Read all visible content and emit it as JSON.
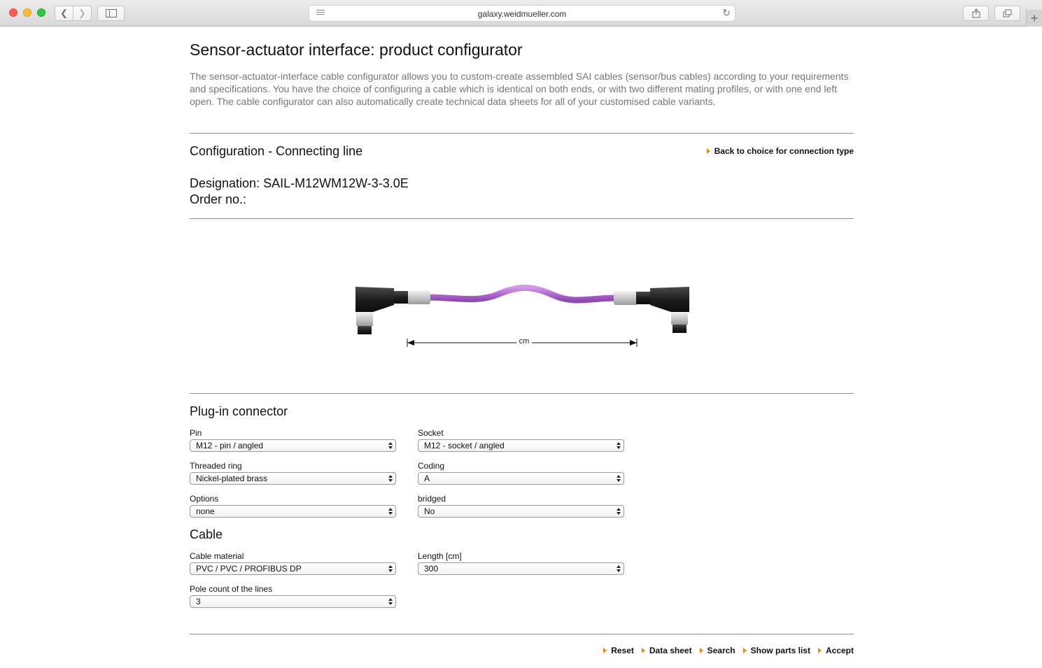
{
  "browser": {
    "url": "galaxy.weidmueller.com"
  },
  "page": {
    "title": "Sensor-actuator interface: product configurator",
    "intro": "The sensor-actuator-interface cable configurator allows you to custom-create assembled SAI cables (sensor/bus cables) according to your requirements and specifications. You have the choice of configuring a cable which is identical on both ends, or with two different mating profiles, or with one end left open. The cable configurator can also automatically create technical data sheets for all of your customised cable variants."
  },
  "configuration": {
    "title": "Configuration - Connecting line",
    "back_link": "Back to choice for connection type",
    "designation": "Designation: SAIL-M12WM12W-3-3.0E",
    "order_no": "Order no.:",
    "dimension_unit": "cm"
  },
  "plugin_connector": {
    "title": "Plug-in connector",
    "pin_label": "Pin",
    "pin_value": "M12 - pin / angled",
    "socket_label": "Socket",
    "socket_value": "M12 - socket / angled",
    "threaded_ring_label": "Threaded ring",
    "threaded_ring_value": "Nickel-plated brass",
    "coding_label": "Coding",
    "coding_value": "A",
    "options_label": "Options",
    "options_value": "none",
    "bridged_label": "bridged",
    "bridged_value": "No"
  },
  "cable": {
    "title": "Cable",
    "material_label": "Cable material",
    "material_value": "PVC / PVC / PROFIBUS DP",
    "length_label": "Length [cm]",
    "length_value": "300",
    "pole_count_label": "Pole count of the lines",
    "pole_count_value": "3"
  },
  "actions": {
    "reset": "Reset",
    "data_sheet": "Data sheet",
    "search": "Search",
    "show_parts_list": "Show parts list",
    "accept": "Accept"
  },
  "colors": {
    "cable": "#b36bd1",
    "accent_arrow": "#e08a1e",
    "intro_text": "#777777"
  }
}
